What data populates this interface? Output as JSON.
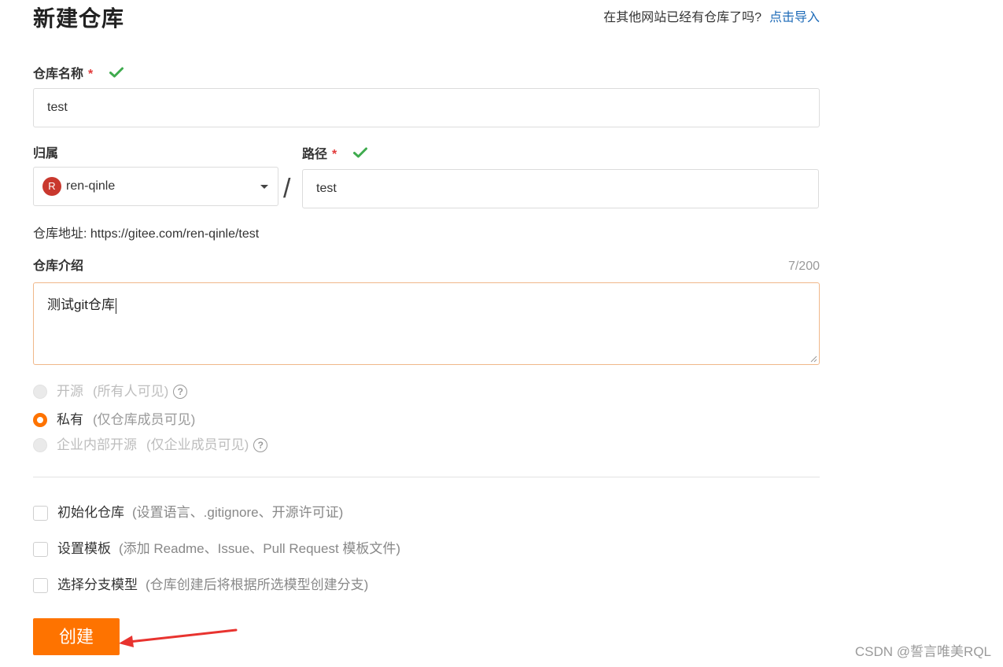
{
  "header": {
    "title": "新建仓库",
    "import_prompt": "在其他网站已经有仓库了吗?",
    "import_link": "点击导入"
  },
  "repo_name": {
    "label": "仓库名称",
    "required_mark": "*",
    "value": "test"
  },
  "owner": {
    "label": "归属",
    "avatar_letter": "R",
    "value": "ren-qinle"
  },
  "separator": "/",
  "path": {
    "label": "路径",
    "required_mark": "*",
    "value": "test"
  },
  "repo_address": "仓库地址: https://gitee.com/ren-qinle/test",
  "description": {
    "label": "仓库介绍",
    "counter": "7/200",
    "value": "测试git仓库"
  },
  "visibility": {
    "options": [
      {
        "label": "开源",
        "hint": "(所有人可见)",
        "state": "disabled"
      },
      {
        "label": "私有",
        "hint": "(仅仓库成员可见)",
        "state": "checked"
      },
      {
        "label": "企业内部开源",
        "hint": "(仅企业成员可见)",
        "state": "disabled"
      }
    ],
    "help_glyph": "?"
  },
  "options": [
    {
      "label": "初始化仓库",
      "hint": "(设置语言、.gitignore、开源许可证)",
      "checked": false
    },
    {
      "label": "设置模板",
      "hint": "(添加 Readme、Issue、Pull Request 模板文件)",
      "checked": false
    },
    {
      "label": "选择分支模型",
      "hint": "(仓库创建后将根据所选模型创建分支)",
      "checked": false
    }
  ],
  "submit": {
    "label": "创建"
  },
  "watermark": "CSDN @誓言唯美RQL",
  "colors": {
    "accent": "#fe7300",
    "link": "#1e6bb8",
    "check_green": "#3fab4e",
    "required_red": "#e23b3b",
    "annotation_arrow": "#e8332f"
  }
}
